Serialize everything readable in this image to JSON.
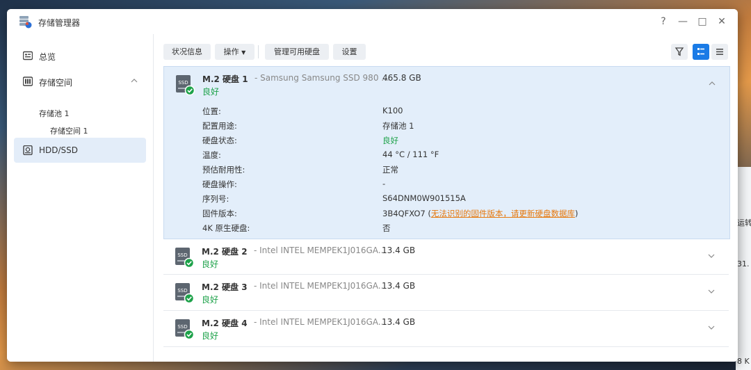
{
  "window": {
    "title": "存储管理器",
    "controls": [
      "?",
      "—",
      "□",
      "✕"
    ]
  },
  "sidebar": {
    "items": [
      {
        "label": "总览",
        "icon": "overview-icon"
      },
      {
        "label": "存储空间",
        "icon": "storage-icon"
      },
      {
        "label": "HDD/SSD",
        "icon": "disk-icon"
      }
    ],
    "sub_items": [
      "存储池 1",
      "存储空间 1"
    ]
  },
  "toolbar": {
    "status_info": "状况信息",
    "action": "操作",
    "manage_disks": "管理可用硬盘",
    "settings": "设置"
  },
  "disks": [
    {
      "name": "M.2 硬盘 1",
      "model": "- Samsung Samsung SSD 980 ...",
      "size": "465.8 GB",
      "status": "良好",
      "expanded": true
    },
    {
      "name": "M.2 硬盘 2",
      "model": "- Intel INTEL MEMPEK1J016GA...",
      "size": "13.4 GB",
      "status": "良好"
    },
    {
      "name": "M.2 硬盘 3",
      "model": "- Intel INTEL MEMPEK1J016GA...",
      "size": "13.4 GB",
      "status": "良好"
    },
    {
      "name": "M.2 硬盘 4",
      "model": "- Intel INTEL MEMPEK1J016GA...",
      "size": "13.4 GB",
      "status": "良好"
    }
  ],
  "details": [
    {
      "label": "位置:",
      "value": "K100"
    },
    {
      "label": "配置用途:",
      "value": "存储池 1"
    },
    {
      "label": "硬盘状态:",
      "value": "良好"
    },
    {
      "label": "温度:",
      "value": "44 °C / 111 °F"
    },
    {
      "label": "预估耐用性:",
      "value": "正常"
    },
    {
      "label": "硬盘操作:",
      "value": "-"
    },
    {
      "label": "序列号:",
      "value": "S64DNM0W901515A"
    },
    {
      "label": "固件版本:",
      "value": "3B4QFXO7",
      "warning": "无法识别的固件版本，请更新硬盘数据库"
    },
    {
      "label": "4K 原生硬盘:",
      "value": "否"
    }
  ],
  "background_text": [
    "运转",
    "31.",
    "8 K"
  ],
  "colors": {
    "accent": "#1a7be6",
    "ok": "#1ea24a",
    "warning": "#e6780c",
    "selected_bg": "#e3eefa"
  }
}
